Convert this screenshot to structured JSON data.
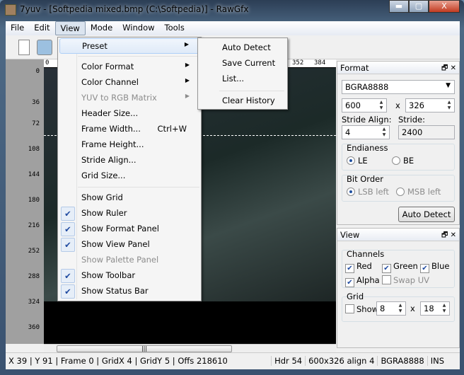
{
  "window": {
    "title": "7yuv - [Softpedia mixed.bmp (C:\\Softpedia)] - RawGfx",
    "minimize": "▬",
    "maximize": "▢",
    "close": "X"
  },
  "menubar": [
    "File",
    "Edit",
    "View",
    "Mode",
    "Window",
    "Tools"
  ],
  "view_menu": [
    {
      "label": "Preset",
      "submenu": true
    },
    {
      "label": "Color Format",
      "submenu": true
    },
    {
      "label": "Color Channel",
      "submenu": true
    },
    {
      "label": "YUV to RGB Matrix",
      "submenu": true,
      "disabled": true
    },
    {
      "label": "Header Size..."
    },
    {
      "label": "Frame Width...",
      "shortcut": "Ctrl+W"
    },
    {
      "label": "Frame Height..."
    },
    {
      "label": "Stride Align..."
    },
    {
      "label": "Grid Size..."
    },
    {
      "label": "Show Grid"
    },
    {
      "label": "Show Ruler",
      "checked": true
    },
    {
      "label": "Show Format Panel",
      "checked": true
    },
    {
      "label": "Show View Panel",
      "checked": true
    },
    {
      "label": "Show Palette Panel",
      "disabled": true
    },
    {
      "label": "Show Toolbar",
      "checked": true
    },
    {
      "label": "Show Status Bar",
      "checked": true
    }
  ],
  "preset_submenu": [
    "Auto Detect",
    "Save Current",
    "List...",
    "Clear History"
  ],
  "ruler": {
    "top": [
      "0",
      "352",
      "384"
    ],
    "left": [
      "0",
      "36",
      "72",
      "108",
      "144",
      "180",
      "216",
      "252",
      "288",
      "324",
      "360"
    ]
  },
  "format_panel": {
    "title": "Format",
    "format": "BGRA8888",
    "width": "600",
    "x": "x",
    "height": "326",
    "stride_align_label": "Stride Align:",
    "stride_align": "4",
    "stride_label": "Stride:",
    "stride": "2400",
    "endianess_label": "Endianess",
    "le": "LE",
    "be": "BE",
    "endian": "LE",
    "bit_order_label": "Bit Order",
    "lsb": "LSB left",
    "msb": "MSB left",
    "auto_detect": "Auto Detect"
  },
  "view_panel": {
    "title": "View",
    "channels_label": "Channels",
    "red": "Red",
    "green": "Green",
    "blue": "Blue",
    "alpha": "Alpha",
    "swap_uv": "Swap UV",
    "grid_label": "Grid",
    "show": "Show",
    "grid_x": "8",
    "x": "x",
    "grid_y": "18"
  },
  "status": {
    "left": "X 39 | Y 91 | Frame 0 | GridX 4 | GridY 5 | Offs 218610",
    "hdr": "Hdr 54",
    "size": "600x326 align 4",
    "format": "BGRA8888",
    "mode": "INS"
  }
}
